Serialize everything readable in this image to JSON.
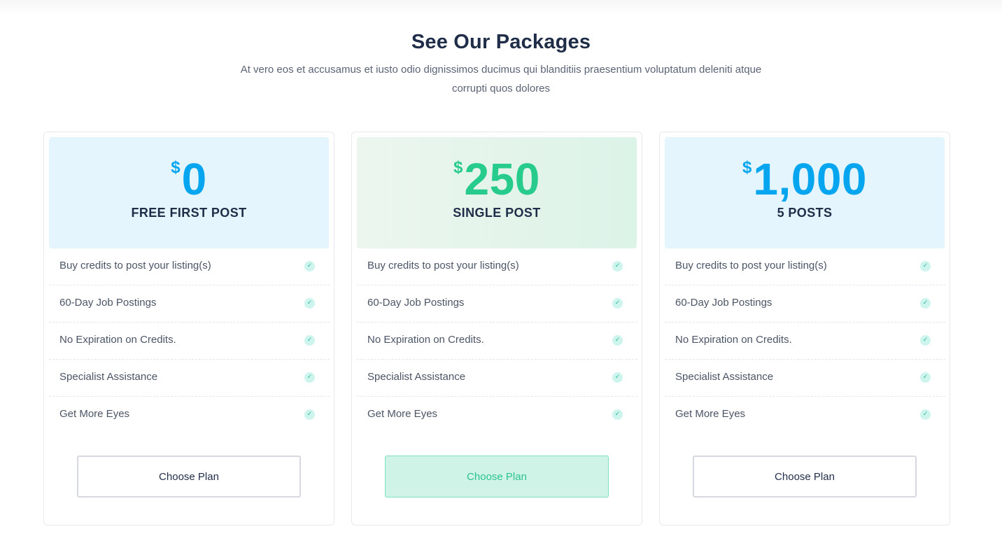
{
  "header": {
    "title": "See Our Packages",
    "subtitle": "At vero eos et accusamus et iusto odio dignissimos ducimus qui blanditiis praesentium voluptatum deleniti atque corrupti quos dolores"
  },
  "plans": [
    {
      "currency": "$",
      "amount": "0",
      "name": "FREE FIRST POST",
      "accent": "#05a6ef",
      "features": [
        "Buy credits to post your listing(s)",
        "60-Day Job Postings",
        "No Expiration on Credits.",
        "Specialist Assistance",
        "Get More Eyes"
      ],
      "button": "Choose Plan"
    },
    {
      "currency": "$",
      "amount": "250",
      "name": "SINGLE POST",
      "accent": "#27cb8c",
      "features": [
        "Buy credits to post your listing(s)",
        "60-Day Job Postings",
        "No Expiration on Credits.",
        "Specialist Assistance",
        "Get More Eyes"
      ],
      "button": "Choose Plan"
    },
    {
      "currency": "$",
      "amount": "1,000",
      "name": "5 POSTS",
      "accent": "#05a6ef",
      "features": [
        "Buy credits to post your listing(s)",
        "60-Day Job Postings",
        "No Expiration on Credits.",
        "Specialist Assistance",
        "Get More Eyes"
      ],
      "button": "Choose Plan"
    }
  ],
  "icons": {
    "feature_check": "check-circle-icon"
  }
}
